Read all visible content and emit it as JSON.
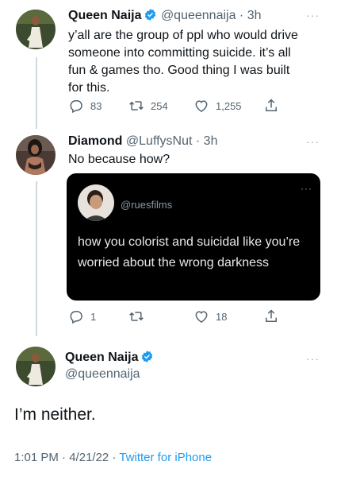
{
  "tweet1": {
    "name": "Queen Naija",
    "handle": "@queennaija",
    "separator": "·",
    "time": "3h",
    "text": "y’all are the group of ppl who would drive someone into committing suicide. it’s all fun & games tho. Good thing I was built for this.",
    "replies": "83",
    "retweets": "254",
    "likes": "1,255"
  },
  "tweet2": {
    "name": "Diamond",
    "handle": "@LuffysNut",
    "separator": "·",
    "time": "3h",
    "text": "No because how?",
    "replies": "1",
    "likes": "18",
    "quote": {
      "handle": "@ruesfilms",
      "text": "how you colorist and suicidal like you’re worried about the wrong darkness"
    }
  },
  "tweet3": {
    "name": "Queen Naija",
    "handle": "@queennaija",
    "text": "I’m neither.",
    "time": "1:01 PM",
    "separator": "·",
    "date": "4/21/22",
    "source": "Twitter for iPhone"
  },
  "icons": {
    "reply": "reply-icon",
    "retweet": "retweet-icon",
    "like": "like-icon",
    "share": "share-icon",
    "verified": "verified-badge-icon",
    "more": "more-options-icon"
  },
  "colors": {
    "text": "#0f1419",
    "secondary": "#536471",
    "link": "#1d9bf0",
    "thread_line": "#cfd9de",
    "quote_bg": "#000000"
  }
}
